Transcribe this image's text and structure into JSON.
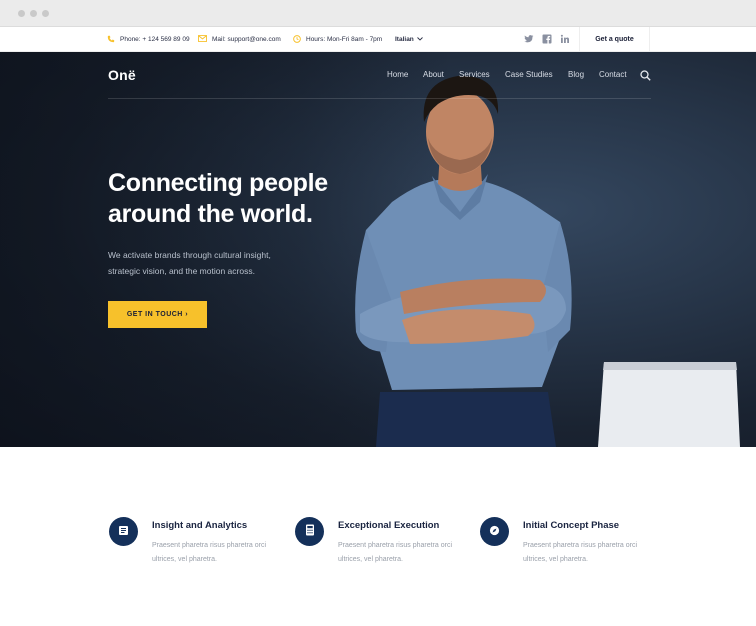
{
  "topbar": {
    "phone": "Phone: + 124 569 89 09",
    "mail": "Mail: support@one.com",
    "hours": "Hours: Mon-Fri 8am - 7pm",
    "language": "Italian",
    "quote_button": "Get a quote"
  },
  "brand": {
    "logo": "Onë"
  },
  "nav": {
    "items": [
      "Home",
      "About",
      "Services",
      "Case Studies",
      "Blog",
      "Contact"
    ]
  },
  "hero": {
    "heading_line1": "Connecting people",
    "heading_line2": "around the world.",
    "subtext_line1": "We activate brands through cultural insight,",
    "subtext_line2": "strategic vision, and the motion across.",
    "cta_label": "GET IN TOUCH ›"
  },
  "features": [
    {
      "title": "Insight and Analytics",
      "desc": "Praesent pharetra risus pharetra orci ultrices, vel pharetra."
    },
    {
      "title": "Exceptional Execution",
      "desc": "Praesent pharetra risus pharetra orci ultrices, vel pharetra."
    },
    {
      "title": "Initial Concept Phase",
      "desc": "Praesent pharetra risus pharetra orci ultrices, vel pharetra."
    }
  ],
  "colors": {
    "accent": "#f7c12b",
    "navy": "#14305a",
    "hero_bg": "#1e2a3a"
  },
  "icons": {
    "phone": "phone-icon",
    "mail": "mail-icon",
    "hours": "clock-icon",
    "twitter": "twitter-icon",
    "facebook": "facebook-icon",
    "linkedin": "linkedin-icon",
    "search": "search-icon",
    "feature_1": "document-icon",
    "feature_2": "calculator-icon",
    "feature_3": "compass-icon"
  }
}
